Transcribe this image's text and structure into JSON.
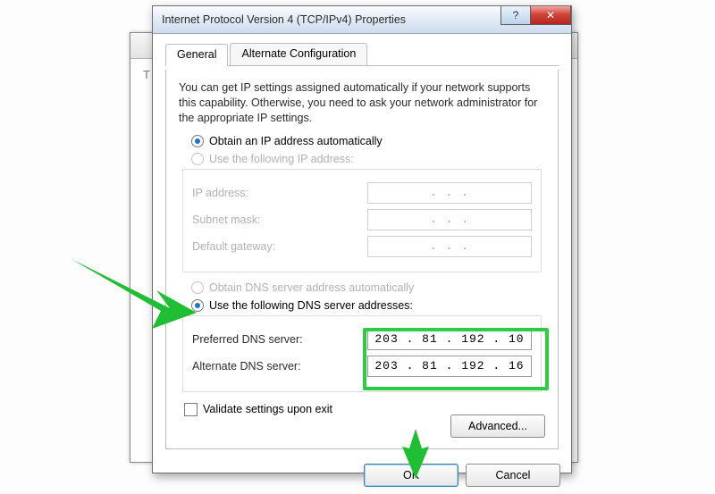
{
  "window": {
    "title": "Internet Protocol Version 4 (TCP/IPv4) Properties",
    "help_glyph": "?",
    "close_glyph": "✕"
  },
  "tabs": {
    "general": "General",
    "alt": "Alternate Configuration"
  },
  "intro_text": "You can get IP settings assigned automatically if your network supports this capability. Otherwise, you need to ask your network administrator for the appropriate IP settings.",
  "ip_section": {
    "auto_label": "Obtain an IP address automatically",
    "manual_label": "Use the following IP address:",
    "ip_label": "IP address:",
    "mask_label": "Subnet mask:",
    "gw_label": "Default gateway:",
    "ip_value": "",
    "mask_value": "",
    "gw_value": "",
    "empty_display": ".       .       ."
  },
  "dns_section": {
    "auto_label": "Obtain DNS server address automatically",
    "manual_label": "Use the following DNS server addresses:",
    "pref_label": "Preferred DNS server:",
    "alt_label": "Alternate DNS server:",
    "pref_value": "203 . 81 . 192 . 10",
    "alt_value": "203 . 81 . 192 . 16"
  },
  "validate_label": "Validate settings upon exit",
  "buttons": {
    "advanced": "Advanced...",
    "ok": "OK",
    "cancel": "Cancel"
  },
  "bg_hint": "T"
}
